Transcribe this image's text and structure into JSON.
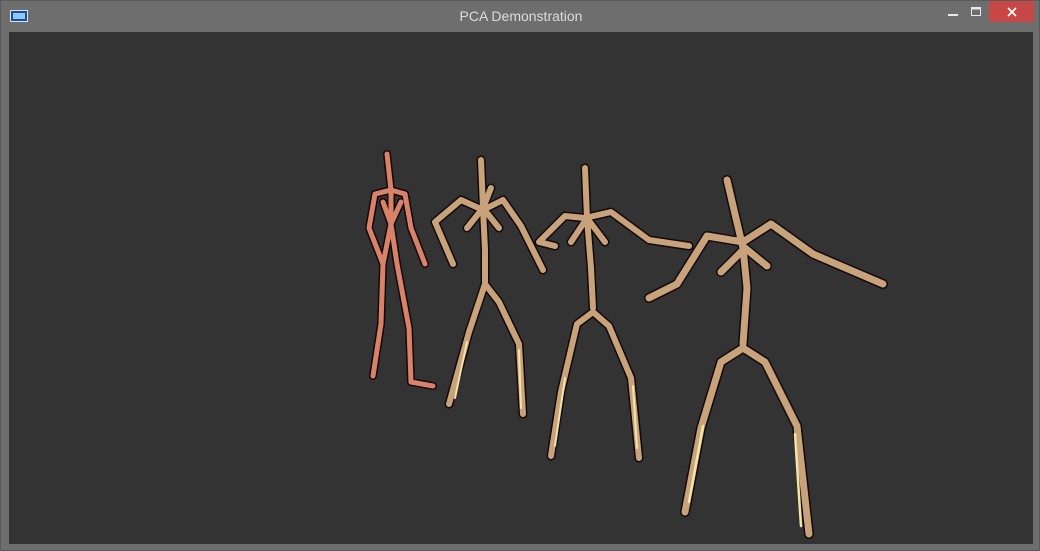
{
  "window": {
    "title": "PCA Demonstration",
    "icons": {
      "app": "app-window-icon",
      "minimize": "minimize-icon",
      "maximize": "maximize-icon",
      "close": "close-icon"
    },
    "colors": {
      "close_button": "#c74646",
      "viewport_background": "#333333",
      "frame": "#6e6e6e"
    }
  },
  "scene": {
    "figure_count": 4,
    "colors": {
      "reference_figure": "#d9826a",
      "pca_figures": "#c8a27a",
      "outline": "#120808"
    }
  }
}
